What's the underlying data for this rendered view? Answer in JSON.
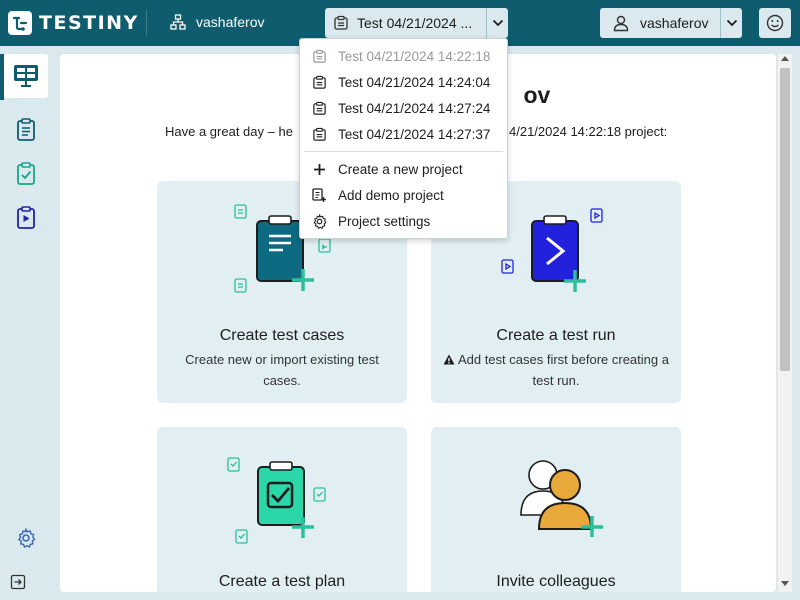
{
  "app": {
    "brand": "TESTINY",
    "org_name": "vashaferov",
    "project_selector_label": "Test 04/21/2024 ...",
    "user_name": "vashaferov"
  },
  "welcome": {
    "title": "ov",
    "subtitle_left": "Have a great day – he",
    "subtitle_right": "4/21/2024 14:22:18 project:"
  },
  "cards": [
    {
      "title": "Create test cases",
      "desc": "Create new or import existing test cases."
    },
    {
      "title": "Create a test run",
      "desc": "Add test cases first before creating a test run.",
      "warning_icon": "warning-icon"
    },
    {
      "title": "Create a test plan",
      "desc": ""
    },
    {
      "title": "Invite colleagues",
      "desc": ""
    }
  ],
  "dropdown": {
    "projects": [
      {
        "label": "Test 04/21/2024 14:22:18",
        "disabled": true
      },
      {
        "label": "Test 04/21/2024 14:24:04",
        "disabled": false
      },
      {
        "label": "Test 04/21/2024 14:27:24",
        "disabled": false
      },
      {
        "label": "Test 04/21/2024 14:27:37",
        "disabled": false
      }
    ],
    "actions": [
      {
        "label": "Create a new project",
        "icon": "plus-icon"
      },
      {
        "label": "Add demo project",
        "icon": "demo-project-icon"
      },
      {
        "label": "Project settings",
        "icon": "gear-icon"
      }
    ]
  },
  "colors": {
    "topbar": "#0e5c6e",
    "sidebar": "#d9e9ee",
    "card_bg": "#e2eff2",
    "accent_teal": "#2bbf9d",
    "run_blue": "#2222dd",
    "invite_orange": "#e8a83a"
  }
}
